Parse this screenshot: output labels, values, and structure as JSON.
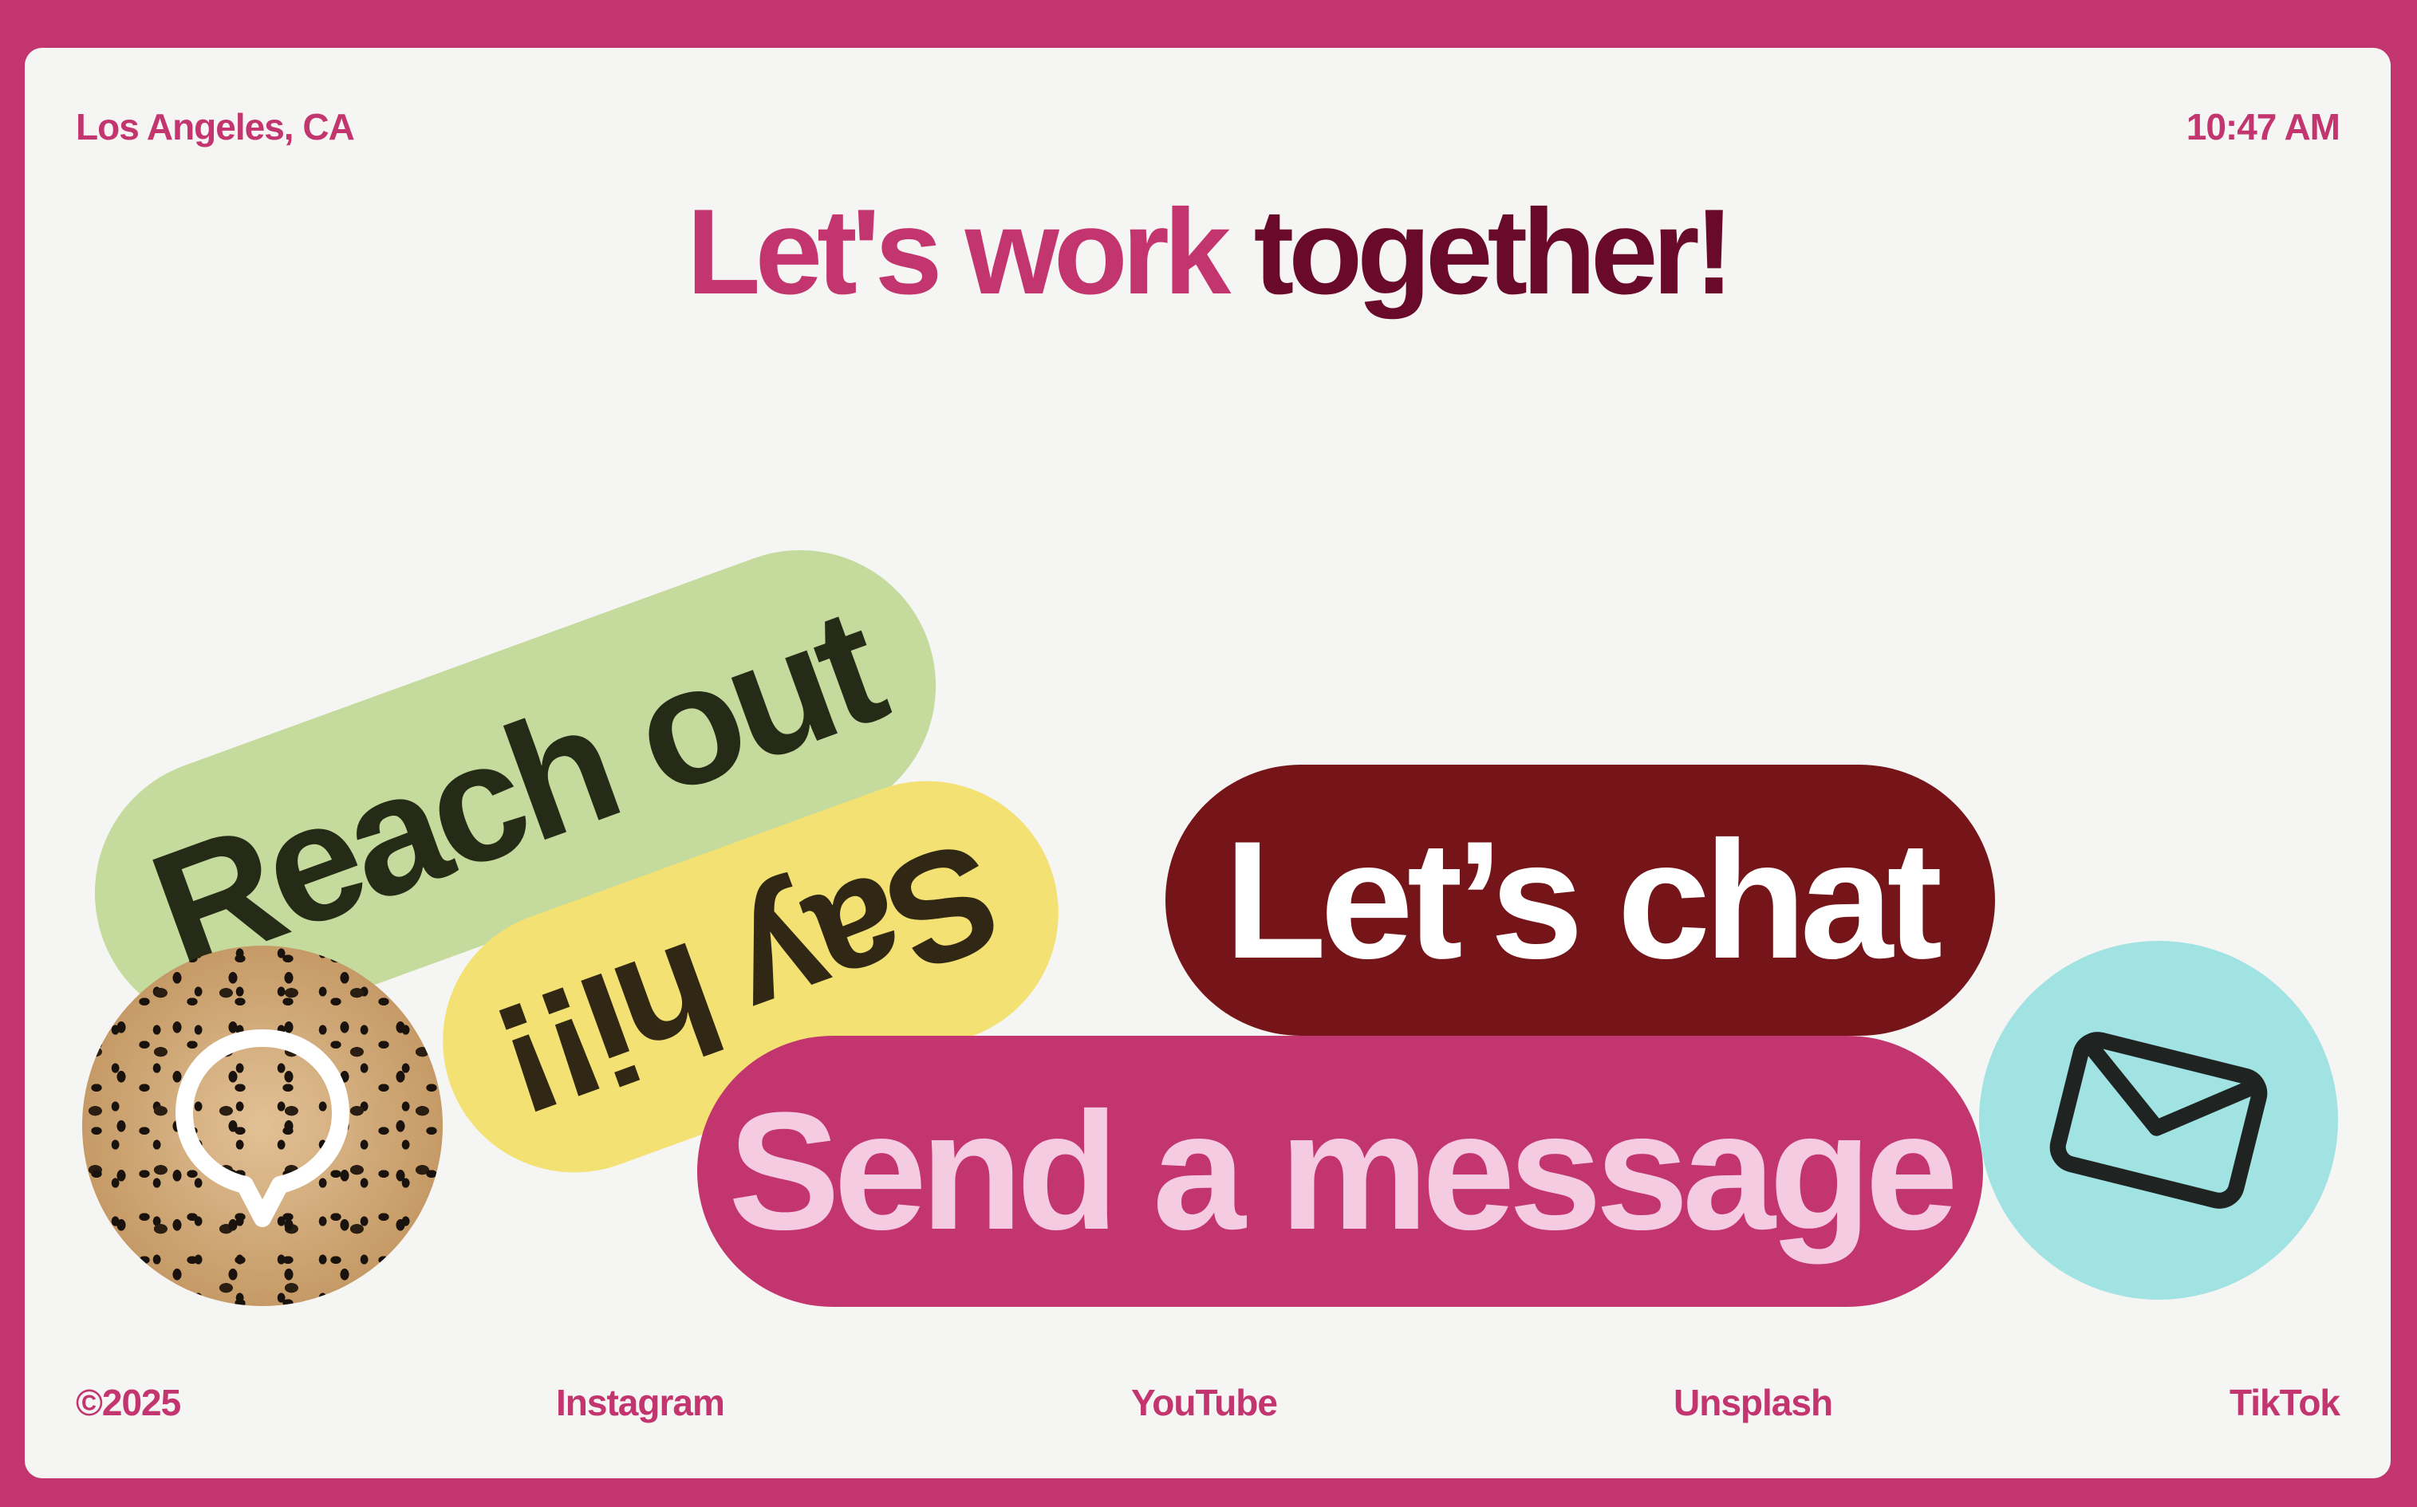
{
  "header": {
    "location": "Los Angeles, CA",
    "time": "10:47 AM"
  },
  "heading": {
    "part1": "Let's work",
    "part2": "together!"
  },
  "buttons": {
    "reach_out": "Reach out",
    "say_hi": "Say hi!!",
    "lets_chat": "Let’s chat",
    "send_message": "Send a message"
  },
  "icons": {
    "chat_bubble": "chat-bubble-icon",
    "envelope": "envelope-icon"
  },
  "footer": {
    "copyright": "©2025",
    "links": [
      "Instagram",
      "YouTube",
      "Unsplash",
      "TikTok"
    ]
  },
  "colors": {
    "brand_pink": "#c3356f",
    "dark_maroon": "#6a0a2a",
    "chat_red": "#751519",
    "green": "#c4db9d",
    "yellow": "#f3e173",
    "cyan": "#a0e3e2",
    "background": "#f5f5f3"
  }
}
